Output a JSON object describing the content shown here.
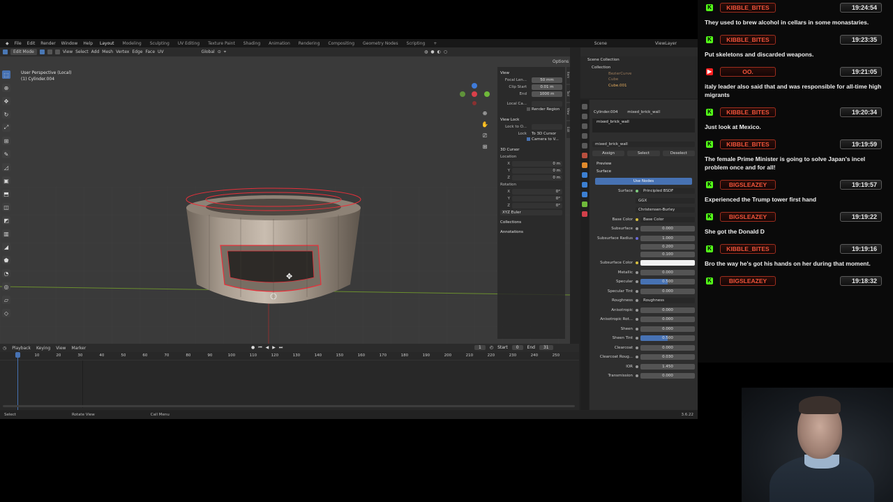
{
  "blender": {
    "menu": [
      "File",
      "Edit",
      "Render",
      "Window",
      "Help"
    ],
    "workspaces": [
      "Layout",
      "Modeling",
      "Sculpting",
      "UV Editing",
      "Texture Paint",
      "Shading",
      "Animation",
      "Rendering",
      "Compositing",
      "Geometry Nodes",
      "Scripting"
    ],
    "active_workspace": "Layout",
    "scene_label": "Scene",
    "view_layer_label": "ViewLayer",
    "viewport": {
      "mode": "Edit Mode",
      "menus": [
        "View",
        "Select",
        "Add",
        "Mesh",
        "Vertex",
        "Edge",
        "Face",
        "UV"
      ],
      "transform_orientation": "Global",
      "options_label": "Options",
      "perspective_label": "User Perspective (Local)",
      "object_label": "(1) Cylinder.004"
    },
    "n_panel": {
      "view_title": "View",
      "focal_label": "Focal Len...",
      "focal_value": "50 mm",
      "clip_start_label": "Clip Start",
      "clip_start_value": "0.01 m",
      "end_label": "End",
      "end_value": "1000 m",
      "local_camera_label": "Local Ca...",
      "render_region_label": "Render Region",
      "view_lock_title": "View Lock",
      "lock_to_label": "Lock to O...",
      "lock_label": "Lock",
      "to_cursor_label": "To 3D Cursor",
      "camera_to_view_label": "Camera to V...",
      "cursor_title": "3D Cursor",
      "location_label": "Location",
      "x_label": "X",
      "y_label": "Y",
      "z_label": "Z",
      "loc_x": "0 m",
      "loc_y": "0 m",
      "loc_z": "0 m",
      "rotation_label": "Rotation",
      "rot_x": "0°",
      "rot_y": "0°",
      "rot_z": "0°",
      "rotation_mode": "XYZ Euler",
      "collections_label": "Collections",
      "annotations_label": "Annotations",
      "tabs": [
        "Item",
        "Tool",
        "View",
        "Edit"
      ]
    },
    "timeline": {
      "menus": [
        "Playback",
        "Keying",
        "View",
        "Marker"
      ],
      "current_frame": "1",
      "start_label": "Start",
      "start_value": "0",
      "end_label": "End",
      "end_value": "31",
      "ruler": [
        "1",
        "10",
        "20",
        "30",
        "40",
        "50",
        "60",
        "70",
        "80",
        "90",
        "100",
        "110",
        "120",
        "130",
        "140",
        "150",
        "160",
        "170",
        "180",
        "190",
        "200",
        "210",
        "220",
        "230",
        "240",
        "250"
      ]
    },
    "statusbar": {
      "select": "Select",
      "rotate": "Rotate View",
      "menu": "Call Menu",
      "version": "3.6.22"
    },
    "outliner": {
      "scene_collection": "Scene Collection",
      "items": [
        "Collection",
        "BezierCurve",
        "Cube",
        "Cube.001"
      ]
    },
    "properties": {
      "breadcrumb_object": "Cylinder.004",
      "breadcrumb_material": "mixed_brick_wall",
      "slot_material": "mixed_brick_wall",
      "material_name": "mixed_brick_wall",
      "assign": "Assign",
      "select": "Select",
      "deselect": "Deselect",
      "preview": "Preview",
      "surface_section": "Surface",
      "use_nodes": "Use Nodes",
      "surface_label": "Surface",
      "surface_value": "Principled BSDF",
      "distribution": "GGX",
      "subsurface_method": "Christensen-Burley",
      "base_color_label": "Base Color",
      "base_color_value": "Base Color",
      "subsurface_label": "Subsurface",
      "subsurface_value": "0.000",
      "subsurface_radius_label": "Subsurface Radius",
      "radius_1": "1.000",
      "radius_2": "0.200",
      "radius_3": "0.100",
      "subsurface_color_label": "Subsurface Color",
      "metallic_label": "Metallic",
      "metallic_value": "0.000",
      "specular_label": "Specular",
      "specular_value": "0.500",
      "specular_tint_label": "Specular Tint",
      "specular_tint_value": "0.000",
      "roughness_label": "Roughness",
      "roughness_value": "Roughness",
      "anisotropic_label": "Anisotropic",
      "anisotropic_value": "0.000",
      "anisotropic_rot_label": "Anisotropic Rot...",
      "anisotropic_rot_value": "0.000",
      "sheen_label": "Sheen",
      "sheen_value": "0.000",
      "sheen_tint_label": "Sheen Tint",
      "sheen_tint_value": "0.500",
      "clearcoat_label": "Clearcoat",
      "clearcoat_value": "0.000",
      "clearcoat_rough_label": "Clearcoat Roug...",
      "clearcoat_rough_value": "0.030",
      "ior_label": "IOR",
      "ior_value": "1.450",
      "transmission_label": "Transmission",
      "transmission_value": "0.000"
    }
  },
  "chat": {
    "messages": [
      {
        "user": "KIBBLE_BITES",
        "time": "19:24:54",
        "text": "They used to brew alcohol in cellars in some monastaries.",
        "platform": "kick"
      },
      {
        "user": "KIBBLE_BITES",
        "time": "19:23:35",
        "text": "Put skeletons and discarded weapons.",
        "platform": "kick"
      },
      {
        "user": "OO.",
        "time": "19:21:05",
        "text": "italy leader also said that and was responsible for all-time high migrants",
        "platform": "youtube"
      },
      {
        "user": "KIBBLE_BITES",
        "time": "19:20:34",
        "text": "Just look at Mexico.",
        "platform": "kick"
      },
      {
        "user": "KIBBLE_BITES",
        "time": "19:19:59",
        "text": "The female Prime Minister is going to solve Japan's incel problem once and for all!",
        "platform": "kick"
      },
      {
        "user": "BIGSLEAZEY",
        "time": "19:19:57",
        "text": "Experienced the Trump tower first hand",
        "platform": "kick"
      },
      {
        "user": "BIGSLEAZEY",
        "time": "19:19:22",
        "text": "She got the Donald D",
        "platform": "kick"
      },
      {
        "user": "KIBBLE_BITES",
        "time": "19:19:16",
        "text": "Bro the way he's got his hands on her during that moment.",
        "platform": "kick"
      },
      {
        "user": "BIGSLEAZEY",
        "time": "19:18:32",
        "text": "",
        "platform": "kick"
      }
    ]
  },
  "colors": {
    "kick_green": "#53fc18",
    "username_red": "#f2543a",
    "blender_blue": "#4772b3",
    "selection_red": "#e8303a"
  }
}
